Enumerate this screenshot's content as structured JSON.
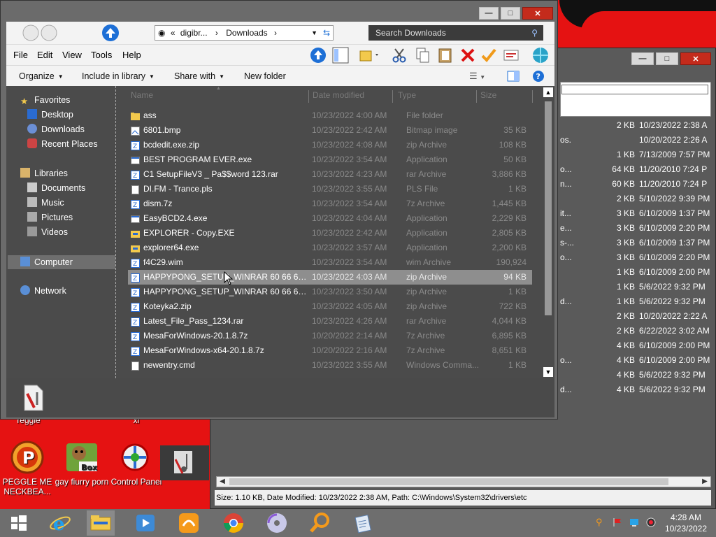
{
  "main_window": {
    "breadcrumb": [
      "«",
      "digibr...",
      "Downloads"
    ],
    "search_placeholder": "Search Downloads",
    "menu": [
      "File",
      "Edit",
      "View",
      "Tools",
      "Help"
    ],
    "commands": [
      "Organize",
      "Include in library",
      "Share with",
      "New folder"
    ],
    "columns": [
      "Name",
      "Date modified",
      "Type",
      "Size"
    ],
    "nav": {
      "favorites": "Favorites",
      "favorites_items": [
        "Desktop",
        "Downloads",
        "Recent Places"
      ],
      "libraries": "Libraries",
      "libraries_items": [
        "Documents",
        "Music",
        "Pictures",
        "Videos"
      ],
      "computer": "Computer",
      "network": "Network"
    },
    "files": [
      {
        "name": "ass",
        "date": "10/23/2022 4:00 AM",
        "type": "File folder",
        "size": "",
        "icon": "folder-icon"
      },
      {
        "name": "6801.bmp",
        "date": "10/23/2022 2:42 AM",
        "type": "Bitmap image",
        "size": "35 KB",
        "icon": "image-icon"
      },
      {
        "name": "bcdedit.exe.zip",
        "date": "10/23/2022 4:08 AM",
        "type": "zip Archive",
        "size": "108 KB",
        "icon": "archive-icon"
      },
      {
        "name": "BEST PROGRAM EVER.exe",
        "date": "10/23/2022 3:54 AM",
        "type": "Application",
        "size": "50 KB",
        "icon": "app-icon"
      },
      {
        "name": "C1 SetupFileV3 _ Pa$$word 123.rar",
        "date": "10/23/2022 4:23 AM",
        "type": "rar Archive",
        "size": "3,886 KB",
        "icon": "archive-icon"
      },
      {
        "name": "DI.FM - Trance.pls",
        "date": "10/23/2022 3:55 AM",
        "type": "PLS File",
        "size": "1 KB",
        "icon": "file-icon"
      },
      {
        "name": "dism.7z",
        "date": "10/23/2022 3:54 AM",
        "type": "7z Archive",
        "size": "1,445 KB",
        "icon": "archive-icon"
      },
      {
        "name": "EasyBCD2.4.exe",
        "date": "10/23/2022 4:04 AM",
        "type": "Application",
        "size": "2,229 KB",
        "icon": "app-icon"
      },
      {
        "name": "EXPLORER - Copy.EXE",
        "date": "10/23/2022 2:42 AM",
        "type": "Application",
        "size": "2,805 KB",
        "icon": "folder-app-icon"
      },
      {
        "name": "explorer64.exe",
        "date": "10/23/2022 3:57 AM",
        "type": "Application",
        "size": "2,200 KB",
        "icon": "folder-app-icon"
      },
      {
        "name": "f4C29.wim",
        "date": "10/23/2022 3:54 AM",
        "type": "wim Archive",
        "size": "190,924 KB",
        "icon": "archive-icon"
      },
      {
        "name": "HAPPYPONG_SETUP_WINRAR 60 66 60 0...",
        "date": "10/23/2022 4:03 AM",
        "type": "zip Archive",
        "size": "94 KB",
        "icon": "archive-icon",
        "selected": true
      },
      {
        "name": "HAPPYPONG_SETUP_WINRAR 60 66 60 0...",
        "date": "10/23/2022 3:50 AM",
        "type": "zip Archive",
        "size": "1 KB",
        "icon": "archive-icon"
      },
      {
        "name": "Koteyka2.zip",
        "date": "10/23/2022 4:05 AM",
        "type": "zip Archive",
        "size": "722 KB",
        "icon": "archive-icon"
      },
      {
        "name": "Latest_File_Pass_1234.rar",
        "date": "10/23/2022 4:26 AM",
        "type": "rar Archive",
        "size": "4,044 KB",
        "icon": "archive-icon"
      },
      {
        "name": "MesaForWindows-20.1.8.7z",
        "date": "10/20/2022 2:14 AM",
        "type": "7z Archive",
        "size": "6,895 KB",
        "icon": "archive-icon"
      },
      {
        "name": "MesaForWindows-x64-20.1.8.7z",
        "date": "10/20/2022 2:16 AM",
        "type": "7z Archive",
        "size": "8,651 KB",
        "icon": "archive-icon"
      },
      {
        "name": "newentry.cmd",
        "date": "10/23/2022 3:55 AM",
        "type": "Windows Comma...",
        "size": "1 KB",
        "icon": "file-icon"
      }
    ]
  },
  "background_window": {
    "rows": [
      {
        "frag": "",
        "size": "2 KB",
        "date": "10/23/2022 2:38 A"
      },
      {
        "frag": "os.",
        "size": "",
        "date": "10/20/2022 2:26 A"
      },
      {
        "frag": "",
        "size": "1 KB",
        "date": "7/13/2009 7:57 PM"
      },
      {
        "frag": "o...",
        "size": "64 KB",
        "date": "11/20/2010 7:24 P"
      },
      {
        "frag": "n...",
        "size": "60 KB",
        "date": "11/20/2010 7:24 P"
      },
      {
        "frag": "",
        "size": "2 KB",
        "date": "5/10/2022 9:39 PM"
      },
      {
        "frag": "it...",
        "size": "3 KB",
        "date": "6/10/2009 1:37 PM"
      },
      {
        "frag": "e...",
        "size": "3 KB",
        "date": "6/10/2009 2:20 PM"
      },
      {
        "frag": "s-...",
        "size": "3 KB",
        "date": "6/10/2009 1:37 PM"
      },
      {
        "frag": "o...",
        "size": "3 KB",
        "date": "6/10/2009 2:20 PM"
      },
      {
        "frag": "",
        "size": "1 KB",
        "date": "6/10/2009 2:00 PM"
      },
      {
        "frag": "",
        "size": "1 KB",
        "date": "5/6/2022 9:32 PM"
      },
      {
        "frag": "d...",
        "size": "1 KB",
        "date": "5/6/2022 9:32 PM"
      },
      {
        "frag": "",
        "size": "2 KB",
        "date": "10/20/2022 2:22 A"
      },
      {
        "frag": "",
        "size": "2 KB",
        "date": "6/22/2022 3:02 AM"
      },
      {
        "frag": "",
        "size": "4 KB",
        "date": "6/10/2009 2:00 PM"
      },
      {
        "frag": "o...",
        "size": "4 KB",
        "date": "6/10/2009 2:00 PM"
      },
      {
        "frag": "",
        "size": "4 KB",
        "date": "5/6/2022 9:32 PM"
      },
      {
        "frag": "d...",
        "size": "4 KB",
        "date": "5/6/2022 9:32 PM"
      }
    ],
    "status": "Size: 1.10 KB, Date Modified: 10/23/2022 2:38 AM, Path: C:\\Windows\\System32\\drivers\\etc"
  },
  "desktop_icons": [
    {
      "label": "reggie",
      "icon": "app-icon"
    },
    {
      "label": "xi",
      "icon": "app-icon"
    },
    {
      "label": "PEGGLE ME NECKBEA...",
      "icon": "peggle-icon"
    },
    {
      "label": "gay fiurry porn",
      "icon": "box-icon"
    },
    {
      "label": "Control Panel",
      "icon": "control-panel-icon"
    }
  ],
  "taskbar": {
    "apps": [
      "windows-start-icon",
      "internet-explorer-icon",
      "file-explorer-icon",
      "media-player-icon",
      "uc-browser-icon",
      "chrome-icon",
      "dvd-icon",
      "search-app-icon",
      "notepad-icon"
    ],
    "time": "4:28 AM",
    "date": "10/23/2022"
  },
  "colors": {
    "desktop_red": "#e51212",
    "window_dark": "#4b4b4b",
    "selection": "#8e8e8e"
  }
}
